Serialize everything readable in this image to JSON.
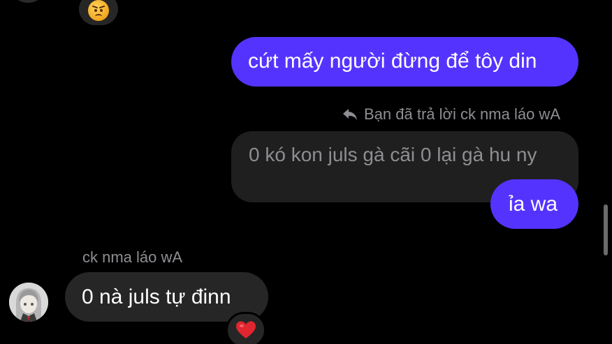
{
  "colors": {
    "background": "#000000",
    "outgoing_bubble": "#5533ff",
    "incoming_bubble": "#262626",
    "quoted_bubble": "#1f1f1f",
    "meta_text": "#8e8e93",
    "reaction_heart": "#e0262f"
  },
  "top_reaction": {
    "icon": "angry-face-emoji"
  },
  "messages": [
    {
      "direction": "outgoing",
      "text": "cứt mấy người đừng để tôy din"
    },
    {
      "direction": "outgoing",
      "reply_context": {
        "icon": "reply-arrow-icon",
        "label": "Bạn đã trả lời ck nma láo wA",
        "quoted_text": "0 kó kon juls gà cãi 0 lại gà hu ny"
      },
      "text": "ỉa wa"
    },
    {
      "direction": "incoming",
      "sender": "ck nma láo wA",
      "text": "0 nà juls tự đinn",
      "reaction": {
        "icon": "red-heart-emoji"
      }
    }
  ]
}
